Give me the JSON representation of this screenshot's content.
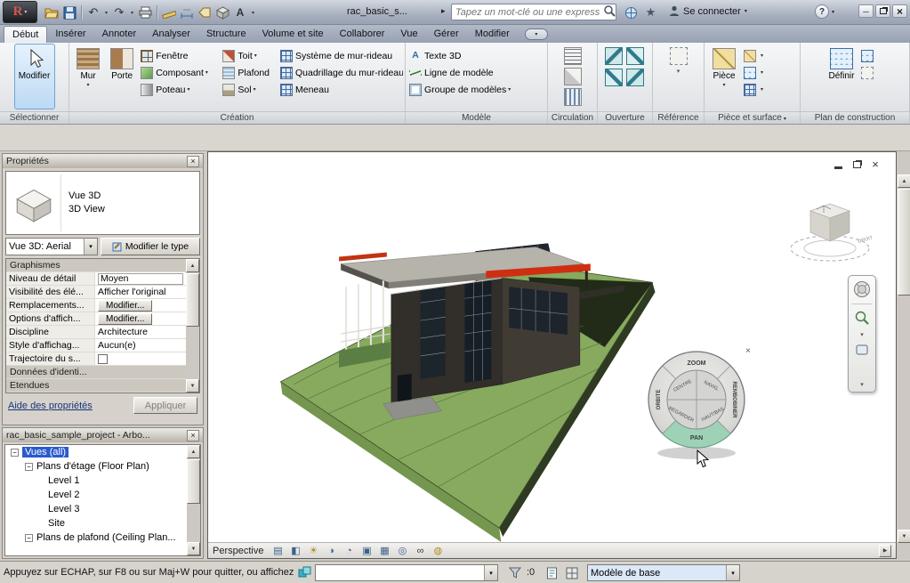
{
  "colors": {
    "accent_selection": "#2a5bcd",
    "tool_highlight": "#cfe4f8",
    "terrain_green": "#87aa5e",
    "terrain_shadow": "#1f2817",
    "roof_gray": "#b6b3ab",
    "beam_red": "#cf2e10",
    "wheel_pan_highlight": "#9ed2b6",
    "design_option_bg": "#dbe8f8"
  },
  "glyphs": {
    "logo_letter": "R",
    "caret": "▾",
    "play": "▸",
    "undo": "↶",
    "redo": "↷",
    "star": "★",
    "minimize": "─",
    "close": "×",
    "plus": "+",
    "minus": "−",
    "up": "▲",
    "down": "▼",
    "right": "▶",
    "dash": "···",
    "text_a": "A"
  },
  "titlebar": {
    "filename": "rac_basic_s...",
    "search_placeholder": "Tapez un mot-clé ou une expressio...",
    "signin_label": "Se connecter",
    "help_label": "?"
  },
  "ribbon": {
    "tabs": [
      "Début",
      "Insérer",
      "Annoter",
      "Analyser",
      "Structure",
      "Volume et site",
      "Collaborer",
      "Vue",
      "Gérer",
      "Modifier"
    ],
    "select": {
      "label": "Sélectionner",
      "modify": "Modifier"
    },
    "creation": {
      "label": "Création",
      "mur": "Mur",
      "porte": "Porte",
      "composant": "Composant",
      "poteau": "Poteau",
      "fenetre": "Fenêtre",
      "toit": "Toit",
      "plafond": "Plafond",
      "sol": "Sol",
      "sys_rideau": "Système de mur-rideau",
      "quad_rideau": "Quadrillage du mur-rideau",
      "meneau": "Meneau"
    },
    "modele": {
      "label": "Modèle",
      "texte3d": "Texte 3D",
      "ligne": "Ligne de modèle",
      "groupe": "Groupe de modèles"
    },
    "circulation": {
      "label": "Circulation"
    },
    "ouverture": {
      "label": "Ouverture"
    },
    "reference": {
      "label": "Référence"
    },
    "piece": {
      "label": "Pièce et surface",
      "piece": "Pièce"
    },
    "plan": {
      "label": "Plan de construction",
      "definir": "Définir"
    }
  },
  "properties": {
    "title": "Propriétés",
    "type_name": "Vue 3D",
    "type_desc": "3D View",
    "type_selector": "Vue 3D: Aerial",
    "edit_type_button": "Modifier le type",
    "rows": [
      {
        "kind": "section",
        "label": "Graphismes",
        "value": ""
      },
      {
        "kind": "combo",
        "label": "Niveau de détail",
        "value": "Moyen"
      },
      {
        "kind": "value",
        "label": "Visibilité des élé...",
        "value": "Afficher l'original"
      },
      {
        "kind": "button",
        "label": "Remplacements...",
        "value": "Modifier..."
      },
      {
        "kind": "button",
        "label": "Options d'affich...",
        "value": "Modifier..."
      },
      {
        "kind": "value",
        "label": "Discipline",
        "value": "Architecture"
      },
      {
        "kind": "value",
        "label": "Style d'affichag...",
        "value": "Aucun(e)"
      },
      {
        "kind": "check",
        "label": "Trajectoire du s...",
        "value": ""
      },
      {
        "kind": "section",
        "label": "Données d'identi...",
        "value": ""
      },
      {
        "kind": "section",
        "label": "Etendues",
        "value": ""
      }
    ],
    "help_link": "Aide des propriétés",
    "apply_button": "Appliquer"
  },
  "browser": {
    "title": "rac_basic_sample_project - Arbo...",
    "views_root": "Vues (all)",
    "floor_plans": "Plans d'étage (Floor Plan)",
    "levels": [
      "Level 1",
      "Level 2",
      "Level 3",
      "Site"
    ],
    "ceiling_plans": "Plans de plafond (Ceiling Plan..."
  },
  "viewport": {
    "view_label": "Perspective",
    "viewcube_label": "DROITE",
    "vc_icons": [
      "▤",
      "◧",
      "☀",
      "◑",
      "◔",
      "▣",
      "▦",
      "◎",
      "∞",
      "◍"
    ],
    "wheel": {
      "zoom": "ZOOM",
      "rewind": "REMBOBINER",
      "pan": "PAN",
      "orbit": "ORBITE",
      "center": "CENTRE",
      "walk": "NAVIG.",
      "look": "REGARDER",
      "updown": "HAUT/BAS"
    }
  },
  "statusbar": {
    "message": "Appuyez sur ECHAP, sur F8 ou sur Maj+W pour quitter, ou affichez",
    "selection_count": ":0",
    "design_option": "Modèle de base"
  }
}
